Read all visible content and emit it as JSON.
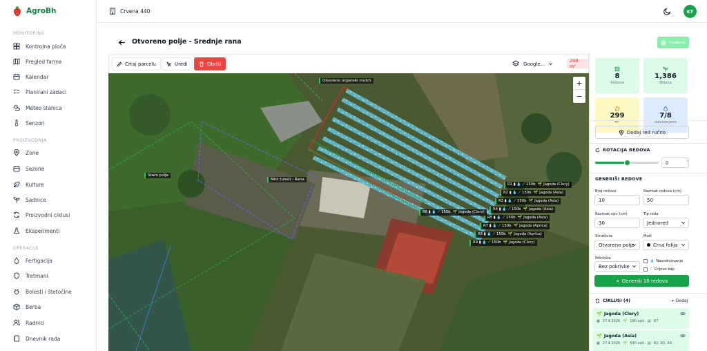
{
  "app": {
    "name": "AgroBh"
  },
  "sidebar": {
    "sections": [
      {
        "title": "MONITORING",
        "items": [
          {
            "label": "Kontrolna ploča",
            "icon": "dashboard-icon"
          },
          {
            "label": "Pregled farme",
            "icon": "map-icon"
          },
          {
            "label": "Kalendar",
            "icon": "calendar-icon"
          },
          {
            "label": "Planirani zadaci",
            "icon": "list-check-icon"
          },
          {
            "label": "Meteo stanica",
            "icon": "weather-icon"
          },
          {
            "label": "Senzori",
            "icon": "thermometer-icon"
          }
        ]
      },
      {
        "title": "PROIZVODNJA",
        "items": [
          {
            "label": "Zone",
            "icon": "location-icon"
          },
          {
            "label": "Sezone",
            "icon": "calendar-icon"
          },
          {
            "label": "Kulture",
            "icon": "leaf-icon"
          },
          {
            "label": "Sadnice",
            "icon": "sprout-icon"
          },
          {
            "label": "Proizvodni ciklusi",
            "icon": "cycle-icon"
          },
          {
            "label": "Eksperimenti",
            "icon": "flask-icon"
          }
        ]
      },
      {
        "title": "OPERACIJE",
        "items": [
          {
            "label": "Fertigacija",
            "icon": "droplet-icon"
          },
          {
            "label": "Tretmani",
            "icon": "shield-icon"
          },
          {
            "label": "Bolesti i štetočine",
            "icon": "bug-icon"
          },
          {
            "label": "Berba",
            "icon": "box-icon"
          },
          {
            "label": "Radnici",
            "icon": "users-icon"
          },
          {
            "label": "Dnevnik rada",
            "icon": "notebook-icon"
          }
        ]
      }
    ]
  },
  "topbar": {
    "farm": "Crvena 440",
    "avatar": "KT"
  },
  "page": {
    "title": "Otvoreno polje - Srednje rana",
    "save_label": "Spremi"
  },
  "toolbar": {
    "draw_label": "Crtaj parcelu",
    "edit_label": "Uredi",
    "delete_label": "Obriši",
    "map_type": "Google...",
    "area": "299 m²"
  },
  "map": {
    "zoom_in": "+",
    "zoom_out": "−",
    "labels": {
      "mulch": "Otvoreno organski mulch",
      "old_field": "Staro polje",
      "mini_tunnel": "Mini tuneli - Rana"
    },
    "rows": [
      {
        "id": "R1",
        "count": "150b",
        "crop": "Jagoda (Clery)"
      },
      {
        "id": "R2",
        "count": "150b",
        "crop": "Jagoda (Asia)"
      },
      {
        "id": "R3",
        "count": "150b",
        "crop": "Jagoda (Asia)"
      },
      {
        "id": "R4",
        "count": "150b",
        "crop": "Jagoda (Asia)"
      },
      {
        "id": "R5",
        "count": "150b",
        "crop": "Jagoda (Asia)"
      },
      {
        "id": "R6",
        "count": "150b",
        "crop": "Jagoda (Clery)"
      },
      {
        "id": "R7",
        "count": "150b",
        "crop": "Jagoda (Aprica)"
      },
      {
        "id": "R8",
        "count": "150b",
        "crop": "Jagoda (Aprica)"
      },
      {
        "id": "R9",
        "count": "150b",
        "crop": "Jagoda (Clery)"
      }
    ]
  },
  "stats": [
    {
      "value": "8",
      "label": "Redova",
      "color": "#dcfce7",
      "icon": "rows-icon"
    },
    {
      "value": "1,386",
      "label": "Biljaka",
      "color": "#dcfce7",
      "icon": "plant-icon"
    },
    {
      "value": "299",
      "label": "m²",
      "color": "#fef9c3",
      "icon": "area-icon"
    },
    {
      "value": "7/8",
      "label": "Navodnjeno",
      "color": "#dbeafe",
      "icon": "droplet-icon"
    }
  ],
  "panel": {
    "add_row": "Dodaj red ručno",
    "rotation_title": "ROTACIJA REDOVA",
    "rotation_value": "0",
    "rotation_unit": "°",
    "rotation_fraction": 0.5,
    "generate_title": "GENERIŠI REDOVE",
    "fields": {
      "row_count_label": "Broj redova",
      "row_count": "10",
      "row_spacing_label": "Razmak redova (cm)",
      "row_spacing": "50",
      "plant_spacing_label": "Razmak npr. (cm)",
      "plant_spacing": "30",
      "row_type_label": "Tip reda",
      "row_type": "Jednored",
      "structure_label": "Struktura",
      "structure": "Otvoreno polje",
      "mulch_label": "Malč",
      "mulch": "Crna folija",
      "coverage_label": "Pokrivka",
      "coverage": "Bez pokrivke",
      "irrigation_cb": "Navodnjavanje",
      "drip_cb": "Crijevo kap"
    },
    "generate_btn": "Generiši 10 redova",
    "cycles_title": "CIKLUSI (4)",
    "add_link": "+ Dodaj",
    "cycles": [
      {
        "name": "Jagoda (Clery)",
        "date": "27.4.2026",
        "plants": "180 sad.",
        "rows": "R7"
      },
      {
        "name": "Jagoda (Asia)",
        "date": "27.4.2026",
        "plants": "540 sad.",
        "rows": "R2, R3, R4"
      }
    ]
  },
  "colors": {
    "brand": "#16a34a",
    "danger": "#ef4444",
    "polygon_red": "#dc2626",
    "polygon_blue": "#6366f1",
    "polygon_green": "#22c55e"
  }
}
